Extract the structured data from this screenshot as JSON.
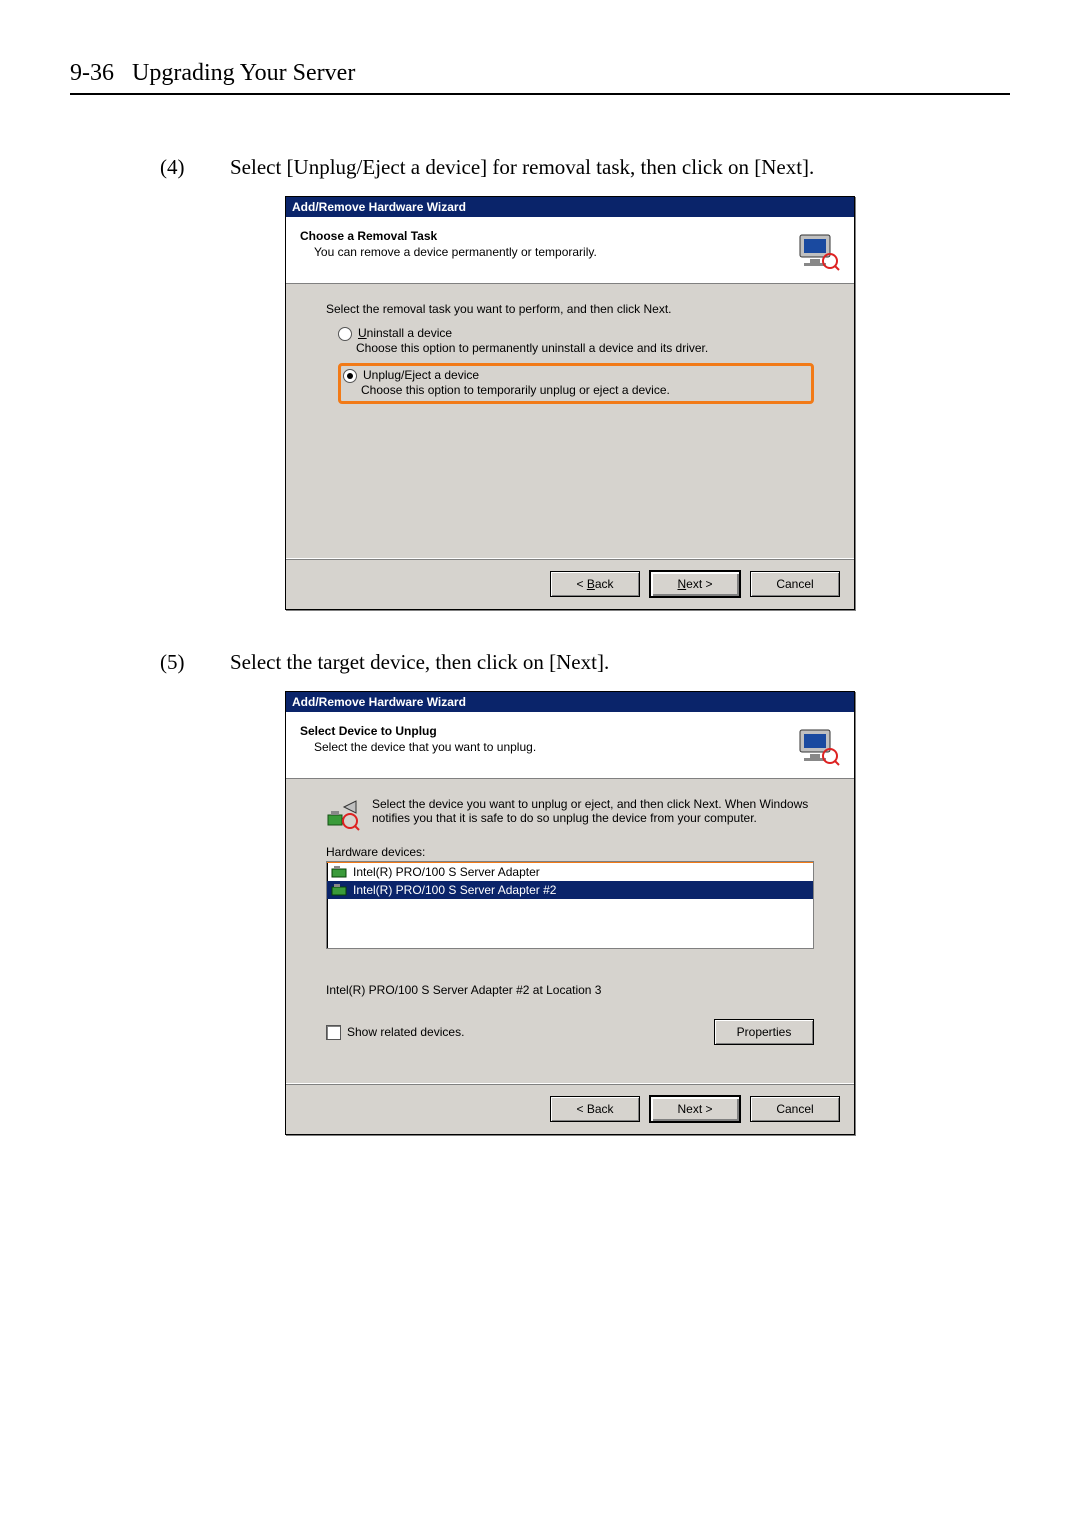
{
  "header": {
    "page_number": "9-36",
    "title": "Upgrading Your Server"
  },
  "steps": {
    "s4": {
      "num": "(4)",
      "text": "Select [Unplug/Eject a device] for removal task, then click on [Next]."
    },
    "s5": {
      "num": "(5)",
      "text": "Select the target device, then click on [Next]."
    }
  },
  "wizard1": {
    "title": "Add/Remove Hardware Wizard",
    "heading": "Choose a Removal Task",
    "subheading": "You can remove a device permanently or temporarily.",
    "intro": "Select the removal task you want to perform, and then click Next.",
    "opt1_u": "U",
    "opt1_rest": "ninstall a device",
    "opt1_desc": "Choose this option to permanently uninstall a device and its driver.",
    "opt2_label": "Unplug/Eject a device",
    "opt2_desc": "Choose this option to temporarily unplug or eject a device.",
    "back_u": "B",
    "back_rest": "ack",
    "next_u": "N",
    "next_rest": "ext >",
    "cancel": "Cancel"
  },
  "wizard2": {
    "title": "Add/Remove Hardware Wizard",
    "heading": "Select Device to Unplug",
    "subheading": "Select the device that you want to unplug.",
    "instr": "Select the device you want to unplug or eject, and then click Next. When Windows notifies you that it is safe to do so unplug the device from your computer.",
    "hw_label": "Hardware devices:",
    "dev1": "Intel(R) PRO/100 S Server Adapter",
    "dev2": "Intel(R) PRO/100 S Server Adapter #2",
    "location": "Intel(R) PRO/100 S Server Adapter #2 at Location 3",
    "show_related": "Show related devices.",
    "properties": "Properties",
    "back": "< Back",
    "next": "Next >",
    "cancel": "Cancel"
  }
}
